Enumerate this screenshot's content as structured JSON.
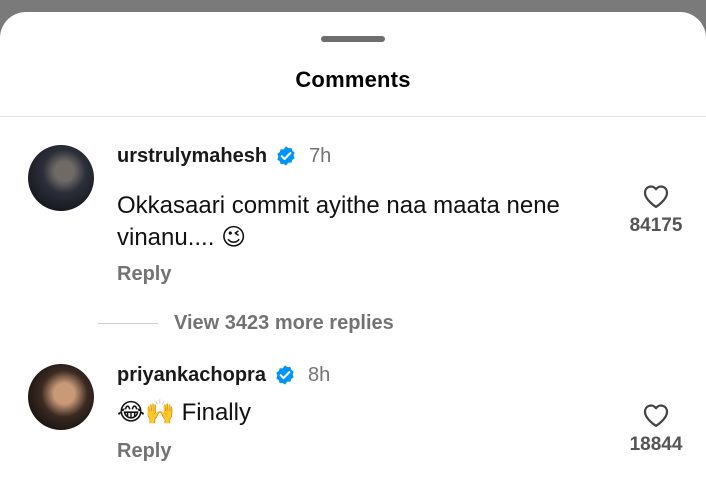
{
  "sheet": {
    "title": "Comments"
  },
  "comments": [
    {
      "username": "urstrulymahesh",
      "time": "7h",
      "text_line1": "Okkasaari commit ayithe naa maata nene",
      "text_line2": "vinanu....",
      "emoji": "😉",
      "reply_label": "Reply",
      "likes": "84175",
      "view_replies": "View 3423 more replies"
    },
    {
      "username": "priyankachopra",
      "time": "8h",
      "emoji_prefix": "😂🙌",
      "text": "Finally",
      "reply_label": "Reply",
      "likes": "18844"
    }
  ],
  "icons": {
    "verified": "verified-badge-icon",
    "like": "heart-outline-icon"
  },
  "colors": {
    "verified": "#0095f6",
    "secondary_text": "#737373"
  }
}
